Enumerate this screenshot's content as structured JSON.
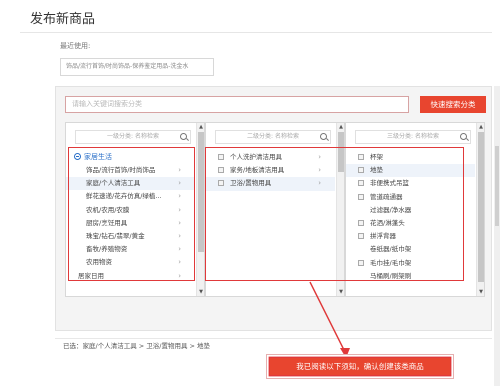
{
  "page": {
    "title": "发布新商品"
  },
  "recent": {
    "label": "最近使用:",
    "chip": "饰品/流行首饰/时尚饰品-保养鉴定用品-洗金水"
  },
  "search": {
    "placeholder": "请输入关键词搜索分类",
    "button_label": "快速搜索分类"
  },
  "columns": {
    "level1": {
      "search_placeholder": "一级分类: 名称检索",
      "group": "家居生活",
      "items": [
        {
          "label": "饰品/流行首饰/时尚饰品",
          "arrow": "›"
        },
        {
          "label": "家庭/个人清洁工具",
          "arrow": "›"
        },
        {
          "label": "鲜花速递/花卉仿真/绿植...",
          "arrow": "›"
        },
        {
          "label": "农机/农用/农膜",
          "arrow": "›"
        },
        {
          "label": "厨房/烹饪用具",
          "arrow": "›"
        },
        {
          "label": "珠宝/钻石/翡翠/黄金",
          "arrow": "›"
        },
        {
          "label": "畜牧/养殖物资",
          "arrow": "›"
        },
        {
          "label": "农用物资",
          "arrow": "›"
        },
        {
          "label": "居家日用",
          "arrow": "›"
        }
      ]
    },
    "level2": {
      "search_placeholder": "二级分类: 名称检索",
      "items": [
        {
          "label": "个人洗护清洁用具",
          "arrow": "›"
        },
        {
          "label": "家务/地板清洁用具",
          "arrow": "›"
        },
        {
          "label": "卫浴/置物用具",
          "arrow": "›"
        }
      ]
    },
    "level3": {
      "search_placeholder": "三级分类: 名称检索",
      "items": [
        {
          "label": "杯架"
        },
        {
          "label": "地垫"
        },
        {
          "label": "非便携式吊篮"
        },
        {
          "label": "管道疏通器"
        },
        {
          "label": "过滤器/净水器"
        },
        {
          "label": "花洒/淋蓬头"
        },
        {
          "label": "拼浮背器"
        },
        {
          "label": "卷纸器/纸巾架"
        },
        {
          "label": "毛巾挂/毛巾架"
        },
        {
          "label": "马桶刷/刷架刷"
        }
      ]
    }
  },
  "selected": {
    "text": "已选：家庭/个人清洁工具 > 卫浴/置物用具 > 地垫"
  },
  "confirm": {
    "label": "我已阅读以下须知，确认创建该类商品"
  },
  "colors": {
    "accent": "#e8452f",
    "highlight": "#e0393a",
    "group_text": "#2a6fc8"
  }
}
